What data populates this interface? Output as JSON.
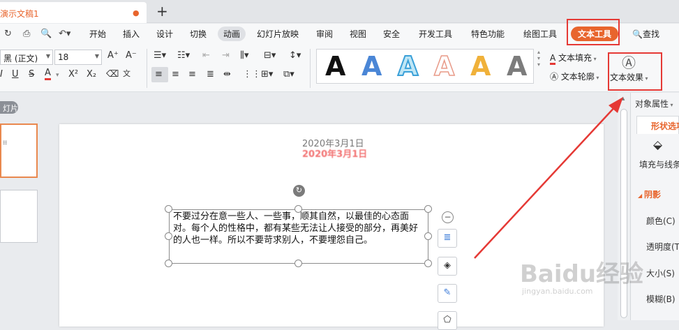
{
  "tabs": {
    "document_tab": "演示文稿1",
    "new_tab_symbol": "+"
  },
  "menu": {
    "items": [
      "开始",
      "插入",
      "设计",
      "切换",
      "动画",
      "幻灯片放映",
      "审阅",
      "视图",
      "安全",
      "开发工具",
      "特色功能",
      "绘图工具",
      "文本工具",
      "查找"
    ],
    "active_tab": "动画",
    "highlighted_tab": "文本工具",
    "accent_color": "#e8652d"
  },
  "ribbon": {
    "font_name": "黑 (正文)",
    "font_size": "18",
    "text_fill_label": "文本填充",
    "text_outline_label": "文本轮廓",
    "text_effect_label": "文本效果",
    "wordart_letter": "A"
  },
  "slide": {
    "date_text": "2020年3月1日",
    "date_reflection": "2020年3月1日",
    "body_text": "不要过分在意一些人、一些事，顺其自然，以最佳的心态面对。每个人的性格中，都有某些无法让人接受的部分，再美好的人也一样。所以不要苛求别人，不要埋怨自己。"
  },
  "left_pane": {
    "tag_label": "灯片"
  },
  "right_panel": {
    "header": "对象属性",
    "tab_label": "形状选项",
    "fill_line_label": "填充与线条",
    "section_shadow": "阴影",
    "color_label": "颜色(C)",
    "transparency_label": "透明度(T)",
    "size_label": "大小(S)",
    "blur_label": "模糊(B)"
  },
  "watermark": {
    "brand": "Baidu经验",
    "url": "jingyan.baidu.com"
  }
}
